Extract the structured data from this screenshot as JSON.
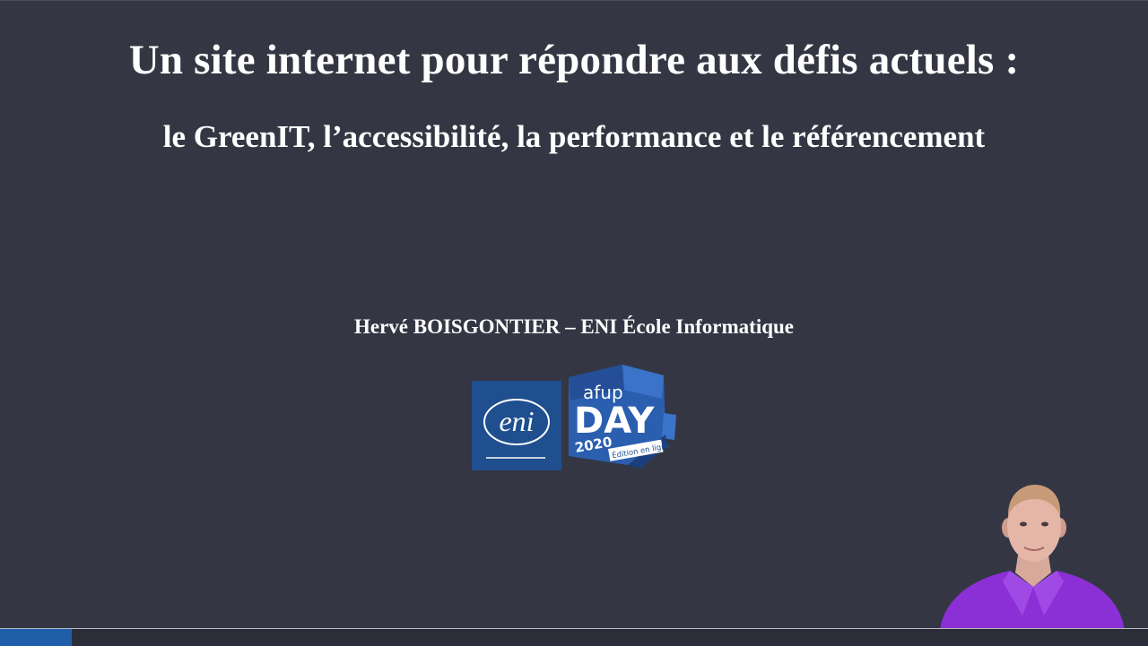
{
  "slide": {
    "title": "Un site internet pour répondre aux défis actuels :",
    "subtitle": "le GreenIT, l’accessibilité, la performance et le référencement",
    "author": "Hervé BOISGONTIER – ENI École Informatique"
  },
  "logos": {
    "eni_text": "eni",
    "afup_text": "afup",
    "day_text": "DAY",
    "year_text": "2020",
    "edition_text": "Édition en ligne"
  },
  "progress": {
    "fraction": 0.0625
  },
  "colors": {
    "background": "#343743",
    "eni_blue": "#1f4f8e",
    "afup_blue": "#2a5fb0",
    "progress": "#1f5ea8"
  }
}
